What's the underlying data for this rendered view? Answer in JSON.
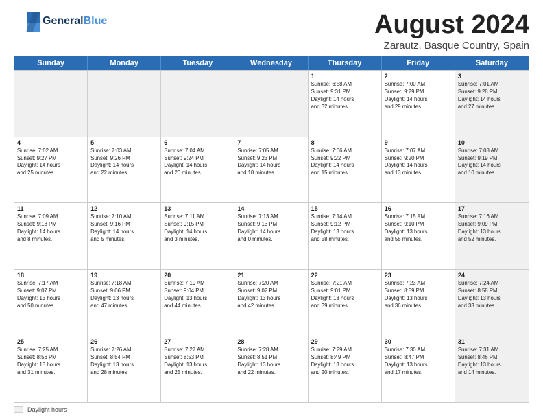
{
  "header": {
    "logo_general": "General",
    "logo_blue": "Blue",
    "month_title": "August 2024",
    "subtitle": "Zarautz, Basque Country, Spain"
  },
  "days_of_week": [
    "Sunday",
    "Monday",
    "Tuesday",
    "Wednesday",
    "Thursday",
    "Friday",
    "Saturday"
  ],
  "weeks": [
    [
      {
        "day": "",
        "info": "",
        "shaded": true
      },
      {
        "day": "",
        "info": "",
        "shaded": true
      },
      {
        "day": "",
        "info": "",
        "shaded": true
      },
      {
        "day": "",
        "info": "",
        "shaded": true
      },
      {
        "day": "1",
        "info": "Sunrise: 6:58 AM\nSunset: 9:31 PM\nDaylight: 14 hours\nand 32 minutes.",
        "shaded": false
      },
      {
        "day": "2",
        "info": "Sunrise: 7:00 AM\nSunset: 9:29 PM\nDaylight: 14 hours\nand 29 minutes.",
        "shaded": false
      },
      {
        "day": "3",
        "info": "Sunrise: 7:01 AM\nSunset: 9:28 PM\nDaylight: 14 hours\nand 27 minutes.",
        "shaded": true
      }
    ],
    [
      {
        "day": "4",
        "info": "Sunrise: 7:02 AM\nSunset: 9:27 PM\nDaylight: 14 hours\nand 25 minutes.",
        "shaded": false
      },
      {
        "day": "5",
        "info": "Sunrise: 7:03 AM\nSunset: 9:26 PM\nDaylight: 14 hours\nand 22 minutes.",
        "shaded": false
      },
      {
        "day": "6",
        "info": "Sunrise: 7:04 AM\nSunset: 9:24 PM\nDaylight: 14 hours\nand 20 minutes.",
        "shaded": false
      },
      {
        "day": "7",
        "info": "Sunrise: 7:05 AM\nSunset: 9:23 PM\nDaylight: 14 hours\nand 18 minutes.",
        "shaded": false
      },
      {
        "day": "8",
        "info": "Sunrise: 7:06 AM\nSunset: 9:22 PM\nDaylight: 14 hours\nand 15 minutes.",
        "shaded": false
      },
      {
        "day": "9",
        "info": "Sunrise: 7:07 AM\nSunset: 9:20 PM\nDaylight: 14 hours\nand 13 minutes.",
        "shaded": false
      },
      {
        "day": "10",
        "info": "Sunrise: 7:08 AM\nSunset: 9:19 PM\nDaylight: 14 hours\nand 10 minutes.",
        "shaded": true
      }
    ],
    [
      {
        "day": "11",
        "info": "Sunrise: 7:09 AM\nSunset: 9:18 PM\nDaylight: 14 hours\nand 8 minutes.",
        "shaded": false
      },
      {
        "day": "12",
        "info": "Sunrise: 7:10 AM\nSunset: 9:16 PM\nDaylight: 14 hours\nand 5 minutes.",
        "shaded": false
      },
      {
        "day": "13",
        "info": "Sunrise: 7:11 AM\nSunset: 9:15 PM\nDaylight: 14 hours\nand 3 minutes.",
        "shaded": false
      },
      {
        "day": "14",
        "info": "Sunrise: 7:13 AM\nSunset: 9:13 PM\nDaylight: 14 hours\nand 0 minutes.",
        "shaded": false
      },
      {
        "day": "15",
        "info": "Sunrise: 7:14 AM\nSunset: 9:12 PM\nDaylight: 13 hours\nand 58 minutes.",
        "shaded": false
      },
      {
        "day": "16",
        "info": "Sunrise: 7:15 AM\nSunset: 9:10 PM\nDaylight: 13 hours\nand 55 minutes.",
        "shaded": false
      },
      {
        "day": "17",
        "info": "Sunrise: 7:16 AM\nSunset: 9:09 PM\nDaylight: 13 hours\nand 52 minutes.",
        "shaded": true
      }
    ],
    [
      {
        "day": "18",
        "info": "Sunrise: 7:17 AM\nSunset: 9:07 PM\nDaylight: 13 hours\nand 50 minutes.",
        "shaded": false
      },
      {
        "day": "19",
        "info": "Sunrise: 7:18 AM\nSunset: 9:06 PM\nDaylight: 13 hours\nand 47 minutes.",
        "shaded": false
      },
      {
        "day": "20",
        "info": "Sunrise: 7:19 AM\nSunset: 9:04 PM\nDaylight: 13 hours\nand 44 minutes.",
        "shaded": false
      },
      {
        "day": "21",
        "info": "Sunrise: 7:20 AM\nSunset: 9:02 PM\nDaylight: 13 hours\nand 42 minutes.",
        "shaded": false
      },
      {
        "day": "22",
        "info": "Sunrise: 7:21 AM\nSunset: 9:01 PM\nDaylight: 13 hours\nand 39 minutes.",
        "shaded": false
      },
      {
        "day": "23",
        "info": "Sunrise: 7:23 AM\nSunset: 8:59 PM\nDaylight: 13 hours\nand 36 minutes.",
        "shaded": false
      },
      {
        "day": "24",
        "info": "Sunrise: 7:24 AM\nSunset: 8:58 PM\nDaylight: 13 hours\nand 33 minutes.",
        "shaded": true
      }
    ],
    [
      {
        "day": "25",
        "info": "Sunrise: 7:25 AM\nSunset: 8:56 PM\nDaylight: 13 hours\nand 31 minutes.",
        "shaded": false
      },
      {
        "day": "26",
        "info": "Sunrise: 7:26 AM\nSunset: 8:54 PM\nDaylight: 13 hours\nand 28 minutes.",
        "shaded": false
      },
      {
        "day": "27",
        "info": "Sunrise: 7:27 AM\nSunset: 8:53 PM\nDaylight: 13 hours\nand 25 minutes.",
        "shaded": false
      },
      {
        "day": "28",
        "info": "Sunrise: 7:28 AM\nSunset: 8:51 PM\nDaylight: 13 hours\nand 22 minutes.",
        "shaded": false
      },
      {
        "day": "29",
        "info": "Sunrise: 7:29 AM\nSunset: 8:49 PM\nDaylight: 13 hours\nand 20 minutes.",
        "shaded": false
      },
      {
        "day": "30",
        "info": "Sunrise: 7:30 AM\nSunset: 8:47 PM\nDaylight: 13 hours\nand 17 minutes.",
        "shaded": false
      },
      {
        "day": "31",
        "info": "Sunrise: 7:31 AM\nSunset: 8:46 PM\nDaylight: 13 hours\nand 14 minutes.",
        "shaded": true
      }
    ]
  ],
  "footer": {
    "box_label": "Daylight hours"
  }
}
